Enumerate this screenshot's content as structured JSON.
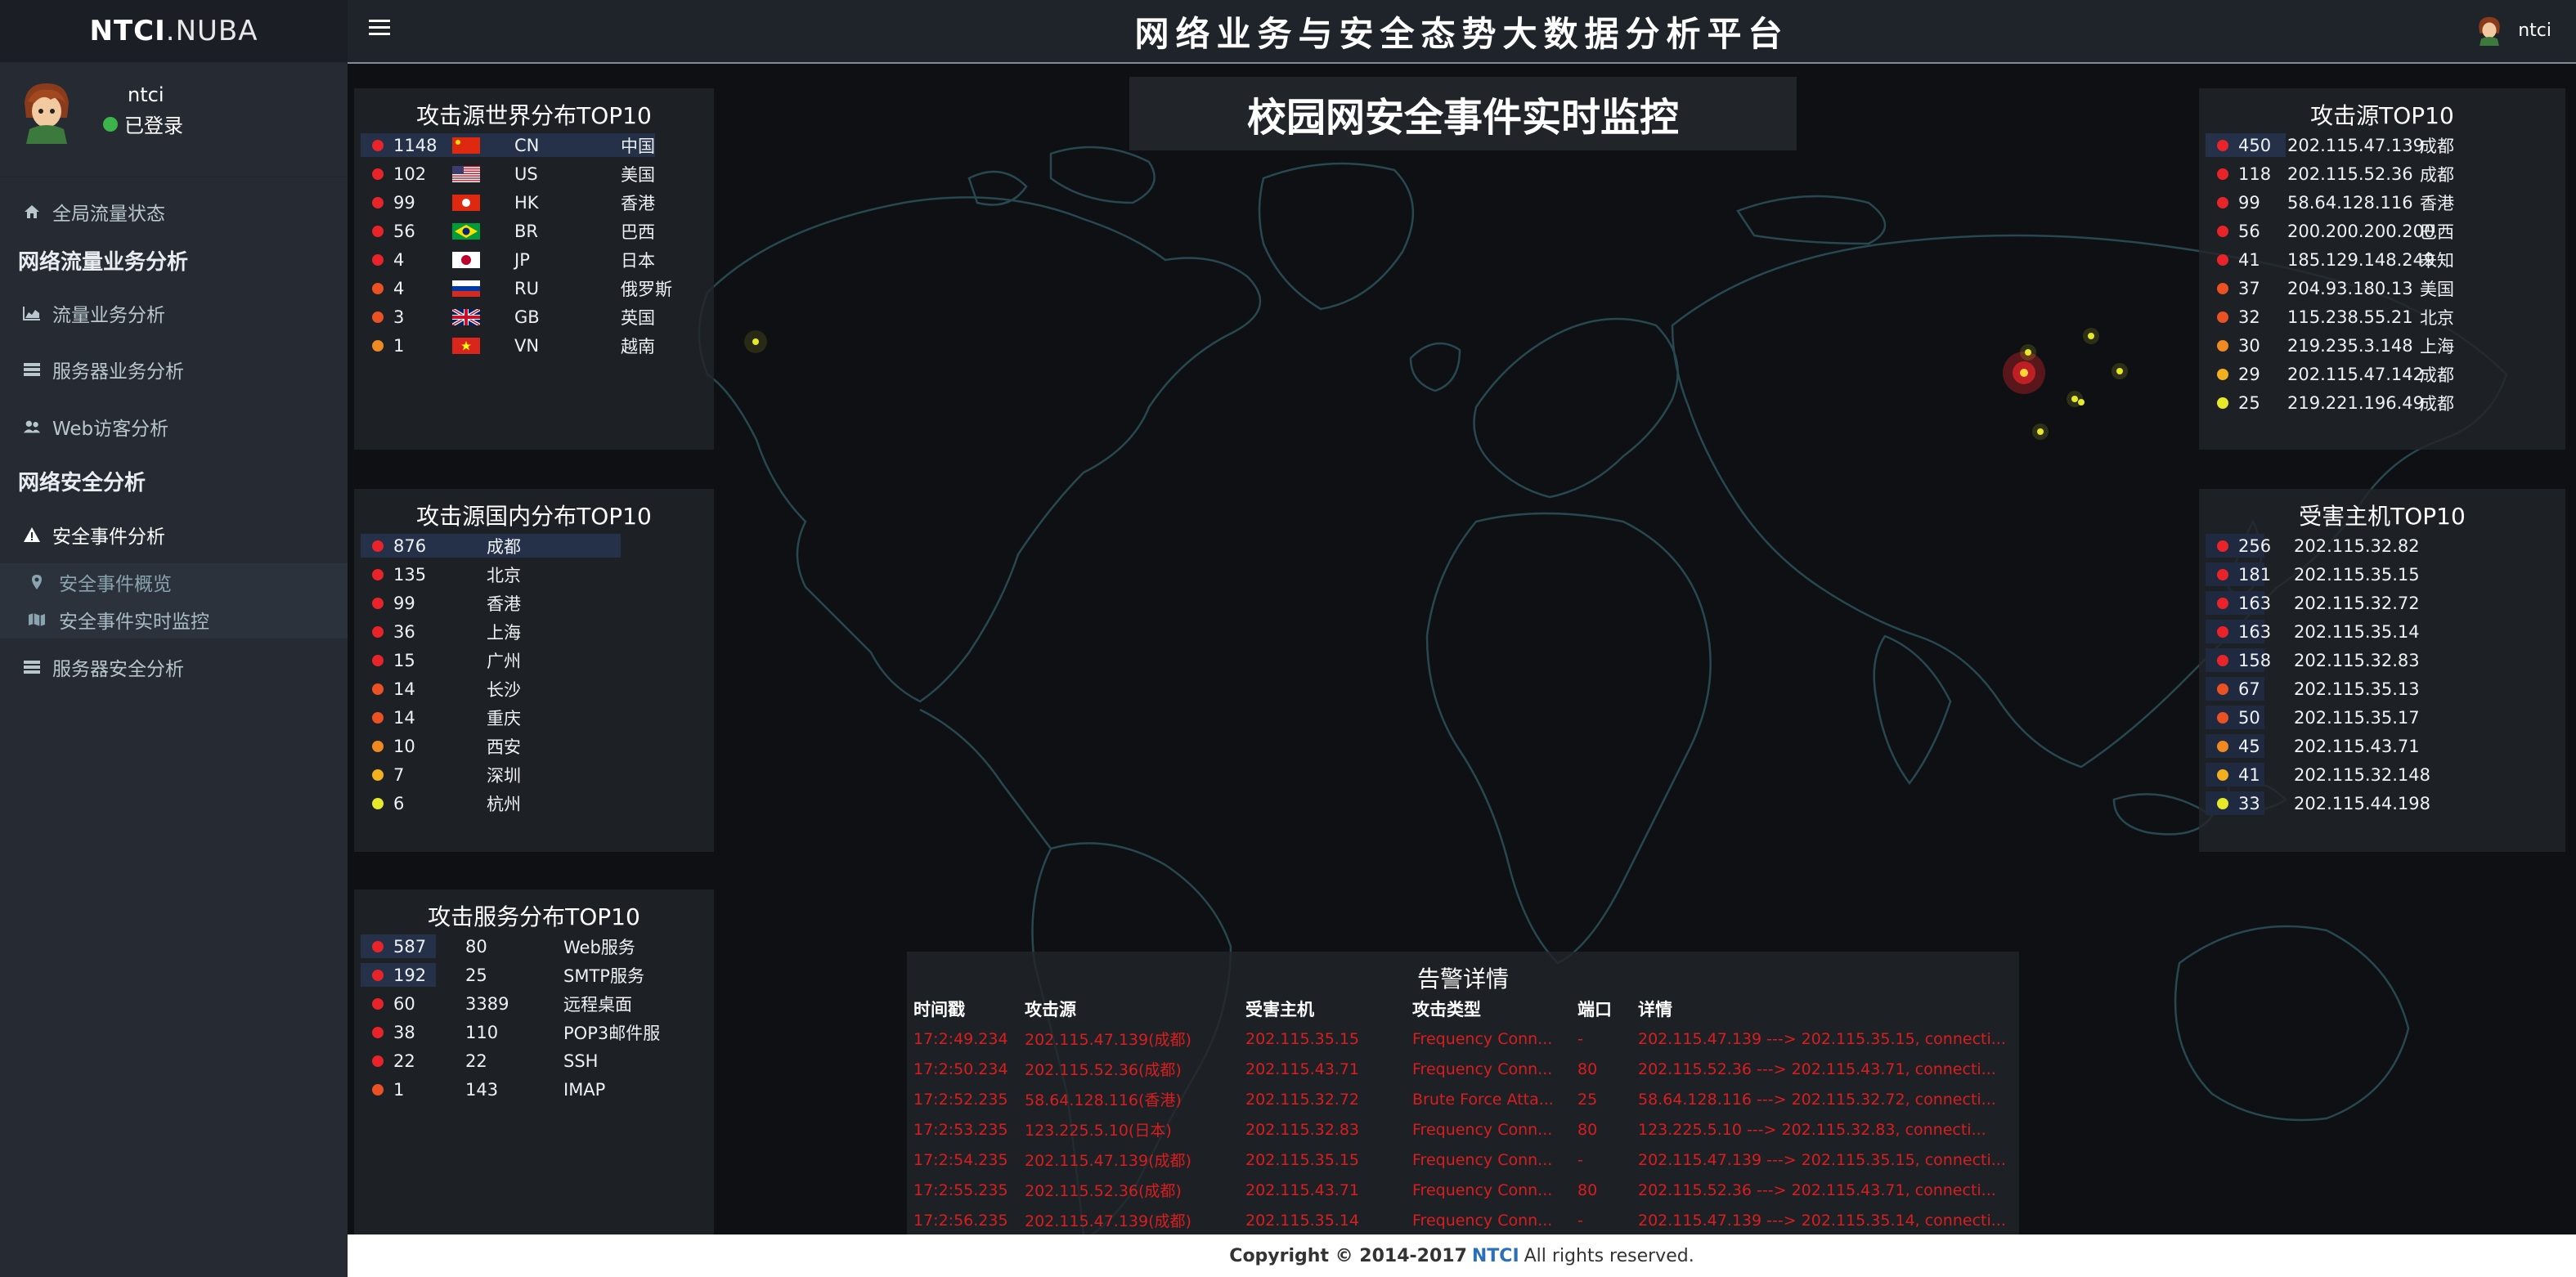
{
  "brand": {
    "bold": "NTCI",
    "thin": ".NUBA"
  },
  "user": {
    "name": "ntci",
    "status": "已登录"
  },
  "sidebar": {
    "items": [
      {
        "label": "全局流量状态",
        "icon": "home-icon"
      },
      {
        "header": "网络流量业务分析"
      },
      {
        "label": "流量业务分析",
        "icon": "area-chart-icon"
      },
      {
        "label": "服务器业务分析",
        "icon": "server-icon"
      },
      {
        "label": "Web访客分析",
        "icon": "users-icon"
      },
      {
        "header": "网络安全分析"
      },
      {
        "label": "安全事件分析",
        "icon": "warning-icon"
      },
      {
        "label": "安全事件概览",
        "icon": "map-marker-icon"
      },
      {
        "label": "安全事件实时监控",
        "icon": "map-icon"
      },
      {
        "label": "服务器安全分析",
        "icon": "server-icon"
      }
    ]
  },
  "header": {
    "title": "网络业务与安全态势大数据分析平台",
    "user": "ntci"
  },
  "page": {
    "title": "校园网安全事件实时监控"
  },
  "colors": {
    "red": "#e8242a",
    "orange_red": "#ea5224",
    "orange": "#ef8a22",
    "amber": "#f2b01f",
    "yellow": "#e6e82a"
  },
  "world_top10": {
    "title": "攻击源世界分布TOP10",
    "rows": [
      {
        "count": "1148",
        "code": "CN",
        "name": "中国",
        "flag": "cn"
      },
      {
        "count": "102",
        "code": "US",
        "name": "美国",
        "flag": "us"
      },
      {
        "count": "99",
        "code": "HK",
        "name": "香港",
        "flag": "hk"
      },
      {
        "count": "56",
        "code": "BR",
        "name": "巴西",
        "flag": "br"
      },
      {
        "count": "4",
        "code": "JP",
        "name": "日本",
        "flag": "jp"
      },
      {
        "count": "4",
        "code": "RU",
        "name": "俄罗斯",
        "flag": "ru"
      },
      {
        "count": "3",
        "code": "GB",
        "name": "英国",
        "flag": "gb"
      },
      {
        "count": "1",
        "code": "VN",
        "name": "越南",
        "flag": "vn"
      }
    ]
  },
  "domestic_top10": {
    "title": "攻击源国内分布TOP10",
    "rows": [
      {
        "count": "876",
        "city": "成都"
      },
      {
        "count": "135",
        "city": "北京"
      },
      {
        "count": "99",
        "city": "香港"
      },
      {
        "count": "36",
        "city": "上海"
      },
      {
        "count": "15",
        "city": "广州"
      },
      {
        "count": "14",
        "city": "长沙"
      },
      {
        "count": "14",
        "city": "重庆"
      },
      {
        "count": "10",
        "city": "西安"
      },
      {
        "count": "7",
        "city": "深圳"
      },
      {
        "count": "6",
        "city": "杭州"
      }
    ]
  },
  "service_top10": {
    "title": "攻击服务分布TOP10",
    "rows": [
      {
        "count": "587",
        "port": "80",
        "service": "Web服务"
      },
      {
        "count": "192",
        "port": "25",
        "service": "SMTP服务"
      },
      {
        "count": "60",
        "port": "3389",
        "service": "远程桌面"
      },
      {
        "count": "38",
        "port": "110",
        "service": "POP3邮件服"
      },
      {
        "count": "22",
        "port": "22",
        "service": "SSH"
      },
      {
        "count": "1",
        "port": "143",
        "service": "IMAP"
      }
    ]
  },
  "source_top10": {
    "title": "攻击源TOP10",
    "rows": [
      {
        "count": "450",
        "ip": "202.115.47.139",
        "loc": "成都"
      },
      {
        "count": "118",
        "ip": "202.115.52.36",
        "loc": "成都"
      },
      {
        "count": "99",
        "ip": "58.64.128.116",
        "loc": "香港"
      },
      {
        "count": "56",
        "ip": "200.200.200.200",
        "loc": "巴西"
      },
      {
        "count": "41",
        "ip": "185.129.148.249",
        "loc": "未知"
      },
      {
        "count": "37",
        "ip": "204.93.180.13",
        "loc": "美国"
      },
      {
        "count": "32",
        "ip": "115.238.55.21",
        "loc": "北京"
      },
      {
        "count": "30",
        "ip": "219.235.3.148",
        "loc": "上海"
      },
      {
        "count": "29",
        "ip": "202.115.47.142",
        "loc": "成都"
      },
      {
        "count": "25",
        "ip": "219.221.196.49",
        "loc": "成都"
      }
    ]
  },
  "victim_top10": {
    "title": "受害主机TOP10",
    "rows": [
      {
        "count": "256",
        "ip": "202.115.32.82"
      },
      {
        "count": "181",
        "ip": "202.115.35.15"
      },
      {
        "count": "163",
        "ip": "202.115.32.72"
      },
      {
        "count": "163",
        "ip": "202.115.35.14"
      },
      {
        "count": "158",
        "ip": "202.115.32.83"
      },
      {
        "count": "67",
        "ip": "202.115.35.13"
      },
      {
        "count": "50",
        "ip": "202.115.35.17"
      },
      {
        "count": "45",
        "ip": "202.115.43.71"
      },
      {
        "count": "41",
        "ip": "202.115.32.148"
      },
      {
        "count": "33",
        "ip": "202.115.44.198"
      }
    ]
  },
  "alerts": {
    "title": "告警详情",
    "columns": [
      "时间戳",
      "攻击源",
      "受害主机",
      "攻击类型",
      "端口",
      "详情"
    ],
    "rows": [
      [
        "17:2:49.234",
        "202.115.47.139(成都)",
        "202.115.35.15",
        "Frequency Conn...",
        "-",
        "202.115.47.139 ---> 202.115.35.15, connecti..."
      ],
      [
        "17:2:50.234",
        "202.115.52.36(成都)",
        "202.115.43.71",
        "Frequency Conn...",
        "80",
        "202.115.52.36 ---> 202.115.43.71, connecti..."
      ],
      [
        "17:2:52.235",
        "58.64.128.116(香港)",
        "202.115.32.72",
        "Brute Force Atta...",
        "25",
        "58.64.128.116 ---> 202.115.32.72, connecti..."
      ],
      [
        "17:2:53.235",
        "123.225.5.10(日本)",
        "202.115.32.83",
        "Frequency Conn...",
        "80",
        "123.225.5.10 ---> 202.115.32.83, connecti..."
      ],
      [
        "17:2:54.235",
        "202.115.47.139(成都)",
        "202.115.35.15",
        "Frequency Conn...",
        "-",
        "202.115.47.139 ---> 202.115.35.15, connecti..."
      ],
      [
        "17:2:55.235",
        "202.115.52.36(成都)",
        "202.115.43.71",
        "Frequency Conn...",
        "80",
        "202.115.52.36 ---> 202.115.43.71, connecti..."
      ],
      [
        "17:2:56.235",
        "202.115.47.139(成都)",
        "202.115.35.14",
        "Frequency Conn...",
        "-",
        "202.115.47.139 ---> 202.115.35.14, connecti..."
      ]
    ]
  },
  "footer": {
    "prefix": "Copyright © 2014-2017",
    "brand": "NTCI",
    "suffix": "All rights reserved."
  }
}
